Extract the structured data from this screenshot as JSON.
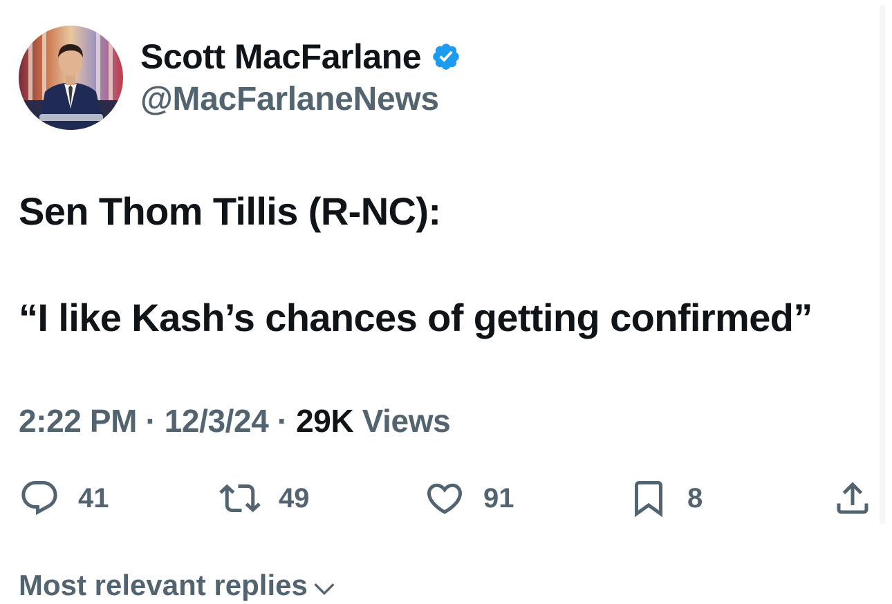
{
  "author": {
    "display_name": "Scott MacFarlane",
    "handle": "@MacFarlaneNews",
    "verified": true,
    "verified_color": "#1d9bf0"
  },
  "tweet": {
    "lines": [
      "Sen Thom Tillis (R-NC):",
      "“I like Kash’s chances of getting confirmed”"
    ]
  },
  "meta": {
    "time": "2:22 PM",
    "separator": " · ",
    "date": "12/3/24",
    "views_count": "29K",
    "views_label": " Views"
  },
  "actions": {
    "replies": "41",
    "retweets": "49",
    "likes": "91",
    "bookmarks": "8"
  },
  "icons": {
    "reply": "speech-bubble-icon",
    "retweet": "retweet-arrows-icon",
    "like": "heart-icon",
    "bookmark": "bookmark-icon",
    "share": "share-upload-icon",
    "dropdown": "chevron-down-icon",
    "verified": "verified-badge-icon"
  },
  "replies_section": {
    "label": "Most relevant replies"
  },
  "colors": {
    "text_primary": "#0f1419",
    "text_secondary": "#536471",
    "accent": "#1d9bf0"
  }
}
